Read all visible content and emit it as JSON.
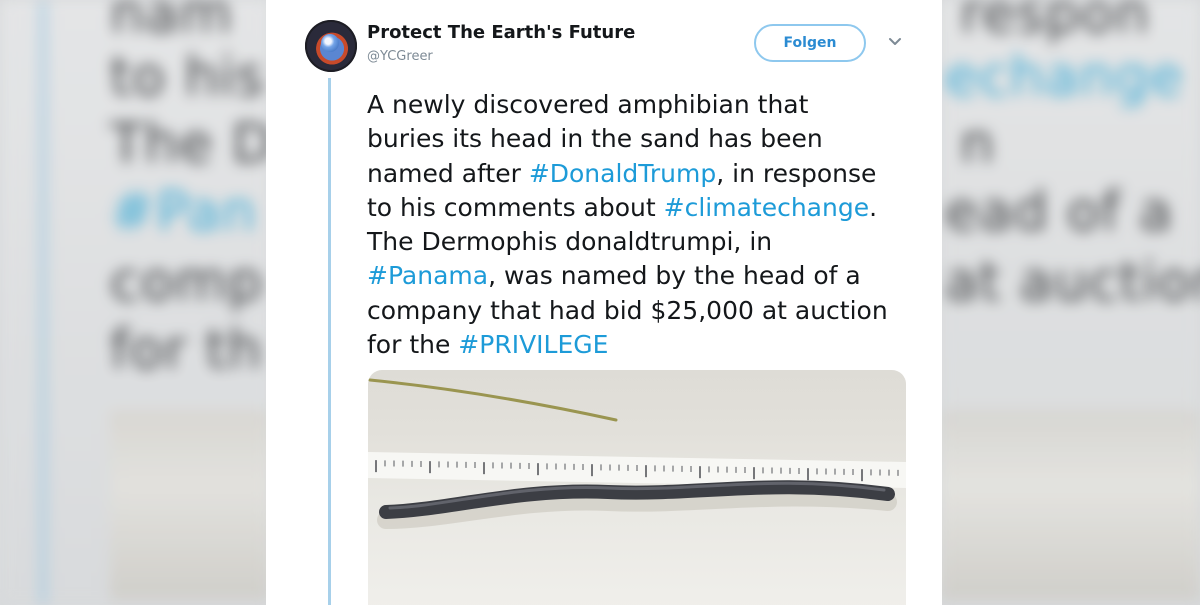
{
  "background_blur": {
    "lines": [
      "nam",
      "to his",
      "The D",
      "#Pan",
      "comp",
      "for th",
      "respon",
      "echange",
      "n",
      "ead of a",
      "at auction"
    ]
  },
  "tweet": {
    "author_name": "Protect The Earth's Future",
    "author_handle": "@YCGreer",
    "follow_label": "Folgen",
    "text_lines": [
      [
        {
          "t": "A newly discovered amphibian that",
          "h": false
        }
      ],
      [
        {
          "t": "buries its head in the sand has been",
          "h": false
        }
      ],
      [
        {
          "t": "named after ",
          "h": false
        },
        {
          "t": "#DonaldTrump",
          "h": true
        },
        {
          "t": ", in response",
          "h": false
        }
      ],
      [
        {
          "t": "to his comments about ",
          "h": false
        },
        {
          "t": "#climatechange",
          "h": true
        },
        {
          "t": ".",
          "h": false
        }
      ],
      [
        {
          "t": "The Dermophis donaldtrumpi, in",
          "h": false
        }
      ],
      [
        {
          "t": "#Panama",
          "h": true
        },
        {
          "t": ", was named by the head of a",
          "h": false
        }
      ],
      [
        {
          "t": "company that had bid $25,000 at auction",
          "h": false
        }
      ],
      [
        {
          "t": "for the ",
          "h": false
        },
        {
          "t": "#PRIVILEGE",
          "h": true
        }
      ]
    ],
    "media": {
      "subject": "caecilian-on-ruler-photo"
    }
  },
  "colors": {
    "hashtag": "#1d9bd8",
    "follow_border": "#8ec8ee",
    "follow_text": "#2b8bd2",
    "thread_line": "#a7d0ea"
  }
}
